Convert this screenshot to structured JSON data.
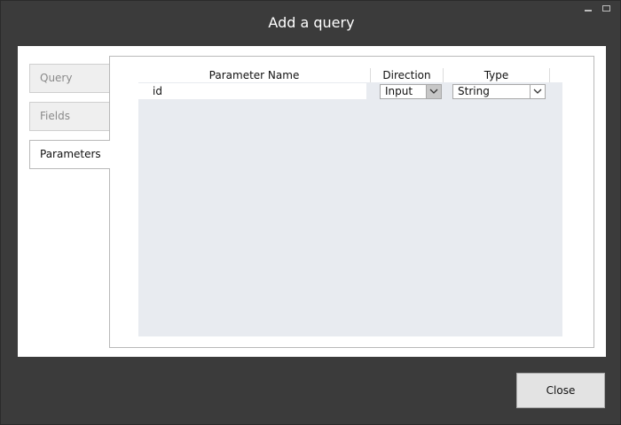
{
  "window": {
    "title": "Add a query"
  },
  "tabs": [
    {
      "label": "Query",
      "selected": false
    },
    {
      "label": "Fields",
      "selected": false
    },
    {
      "label": "Parameters",
      "selected": true
    }
  ],
  "grid": {
    "columns": [
      "Parameter Name",
      "Direction",
      "Type"
    ],
    "rows": [
      {
        "name": "id",
        "direction": "Input",
        "type": "String"
      }
    ]
  },
  "footer": {
    "close_label": "Close"
  }
}
